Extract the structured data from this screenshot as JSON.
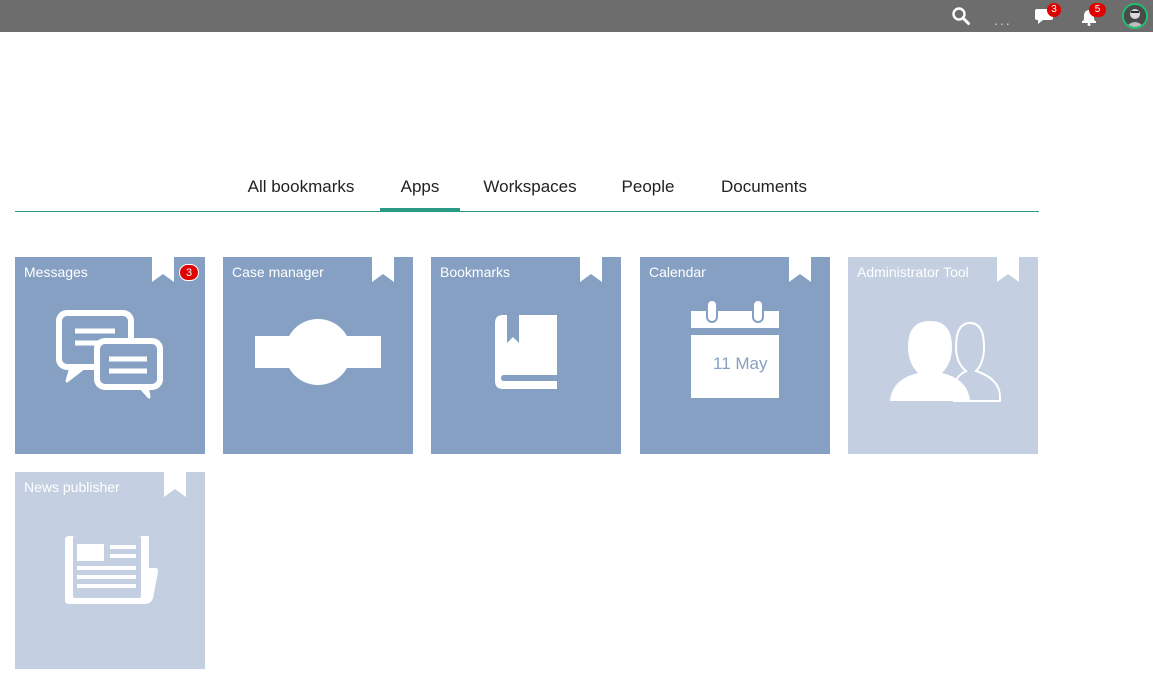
{
  "topbar": {
    "more_label": "...",
    "chat_count": "3",
    "notification_count": "5",
    "icons": [
      "search-icon",
      "more-icon",
      "chat-icon",
      "notification-icon",
      "avatar"
    ]
  },
  "tabs": [
    {
      "label": "All bookmarks",
      "active": false
    },
    {
      "label": "Apps",
      "active": true
    },
    {
      "label": "Workspaces",
      "active": false
    },
    {
      "label": "People",
      "active": false
    },
    {
      "label": "Documents",
      "active": false
    }
  ],
  "apps": [
    {
      "title": "Messages",
      "badge": "3",
      "icon": "messages-icon"
    },
    {
      "title": "Case manager",
      "icon": "case-manager-icon"
    },
    {
      "title": "Bookmarks",
      "icon": "book-icon"
    },
    {
      "title": "Calendar",
      "date": "11 May",
      "icon": "calendar-icon"
    },
    {
      "title": "Administrator Tool",
      "icon": "users-icon"
    },
    {
      "title": "News publisher",
      "icon": "newspaper-icon"
    }
  ],
  "colors": {
    "topbar": "#6d6d6d",
    "accent": "#2a9a85",
    "tile": "#86a0c3",
    "tile_light": "#c4d0e1",
    "badge": "#e00000"
  }
}
